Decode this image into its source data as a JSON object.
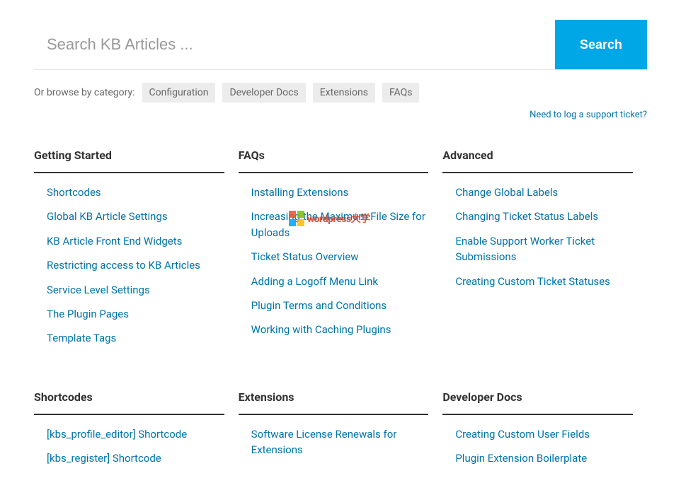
{
  "search": {
    "placeholder": "Search KB Articles ...",
    "button_label": "Search"
  },
  "browse": {
    "label": "Or browse by category:",
    "categories": [
      "Configuration",
      "Developer Docs",
      "Extensions",
      "FAQs"
    ]
  },
  "support_link": "Need to log a support ticket?",
  "watermark": "wordpress大学",
  "sections_row1": [
    {
      "title": "Getting Started",
      "articles": [
        "Shortcodes",
        "Global KB Article Settings",
        "KB Article Front End Widgets",
        "Restricting access to KB Articles",
        "Service Level Settings",
        "The Plugin Pages",
        "Template Tags"
      ]
    },
    {
      "title": "FAQs",
      "articles": [
        "Installing Extensions",
        "Increasing the Maximum File Size for Uploads",
        "Ticket Status Overview",
        "Adding a Logoff Menu Link",
        "Plugin Terms and Conditions",
        "Working with Caching Plugins"
      ]
    },
    {
      "title": "Advanced",
      "articles": [
        "Change Global Labels",
        "Changing Ticket Status Labels",
        "Enable Support Worker Ticket Submissions",
        "Creating Custom Ticket Statuses"
      ]
    }
  ],
  "sections_row2": [
    {
      "title": "Shortcodes",
      "articles": [
        "[kbs_profile_editor] Shortcode",
        "[kbs_register] Shortcode"
      ]
    },
    {
      "title": "Extensions",
      "articles": [
        "Software License Renewals for Extensions"
      ]
    },
    {
      "title": "Developer Docs",
      "articles": [
        "Creating Custom User Fields",
        "Plugin Extension Boilerplate"
      ]
    }
  ]
}
